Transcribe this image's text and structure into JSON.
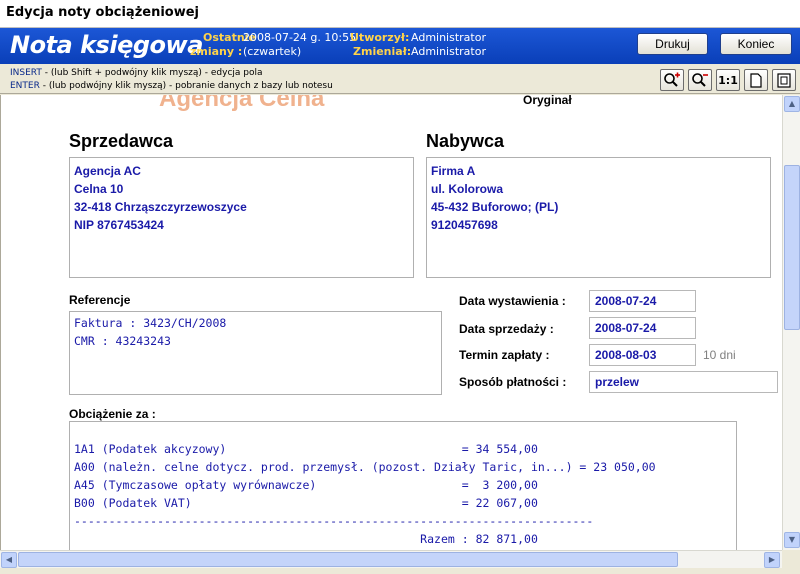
{
  "window": {
    "title": "Edycja noty obciążeniowej"
  },
  "banner": {
    "logo": "Nota księgowa",
    "ostatnie_label": "Ostatnie",
    "ostatnie_value": "2008-07-24 g. 10:55",
    "zmiany_label": "zmiany :",
    "zmiany_value": "(czwartek)",
    "utworzyl_label": "Utworzył:",
    "utworzyl_value": "Administrator",
    "zmienial_label": "Zmieniał:",
    "zmienial_value": "Administrator"
  },
  "buttons": {
    "print": "Drukuj",
    "close": "Koniec"
  },
  "hints": {
    "line1_key": "INSERT",
    "line1_text": "- (lub Shift + podwójny klik myszą) - edycja pola",
    "line2_key": "ENTER",
    "line2_text": "- (lub podwójny klik myszą) - pobranie danych z bazy lub notesu"
  },
  "toolbar": {
    "tools": [
      {
        "name": "zoom-in-icon",
        "glyph": "🔍+"
      },
      {
        "name": "zoom-out-icon",
        "glyph": "🔍−"
      },
      {
        "name": "actual-size-button",
        "glyph": "1:1"
      },
      {
        "name": "page-icon",
        "glyph": "🗋"
      },
      {
        "name": "page-fit-icon",
        "glyph": "🗍"
      }
    ]
  },
  "document": {
    "watermark": "Agencja Celna",
    "original_label": "Oryginał",
    "seller": {
      "heading": "Sprzedawca",
      "lines": [
        "Agencja AC",
        "Celna 10",
        "32-418 Chrząszczyrzewoszyce",
        "NIP 8767453424"
      ]
    },
    "buyer": {
      "heading": "Nabywca",
      "lines": [
        "Firma A",
        "ul. Kolorowa",
        "45-432 Buforowo; (PL)",
        "9120457698"
      ]
    },
    "references": {
      "heading": "Referencje",
      "lines": [
        "Faktura : 3423/CH/2008",
        "CMR : 43243243"
      ]
    },
    "dates": {
      "issue_label": "Data wystawienia :",
      "issue_value": "2008-07-24",
      "sale_label": "Data sprzedaży :",
      "sale_value": "2008-07-24",
      "due_label": "Termin zapłaty :",
      "due_value": "2008-08-03",
      "due_days": "10 dni",
      "payment_label": "Sposób płatności :",
      "payment_value": "przelew"
    },
    "charges": {
      "heading": "Obciążenie za :",
      "lines": [
        "1A1 (Podatek akcyzowy)                                  = 34 554,00",
        "A00 (należn. celne dotycz. prod. przemysł. (pozost. Działy Taric, in...) = 23 050,00",
        "A45 (Tymczasowe opłaty wyrównawcze)                     =  3 200,00",
        "B00 (Podatek VAT)                                       = 22 067,00",
        "---------------------------------------------------------------------------",
        "                                                  Razem : 82 871,00"
      ]
    }
  }
}
